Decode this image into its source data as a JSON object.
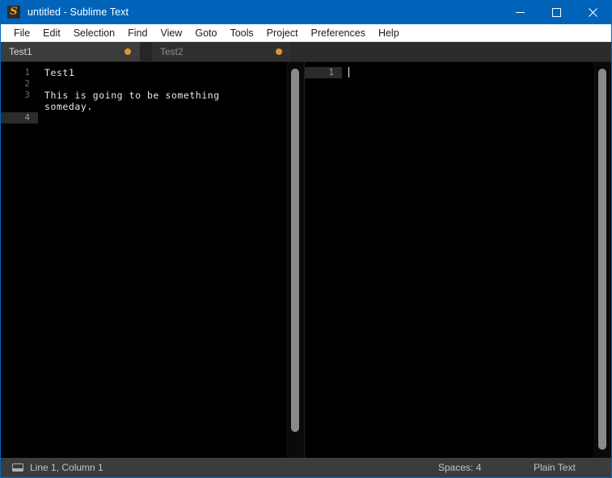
{
  "window": {
    "title": "untitled - Sublime Text",
    "logo_icon": "sublime-text-logo-icon",
    "controls": {
      "minimize": "minimize-icon",
      "maximize": "maximize-icon",
      "close": "close-icon"
    },
    "accent_color": "#0064ba"
  },
  "menubar": {
    "items": [
      {
        "label": "File"
      },
      {
        "label": "Edit"
      },
      {
        "label": "Selection"
      },
      {
        "label": "Find"
      },
      {
        "label": "View"
      },
      {
        "label": "Goto"
      },
      {
        "label": "Tools"
      },
      {
        "label": "Project"
      },
      {
        "label": "Preferences"
      },
      {
        "label": "Help"
      }
    ]
  },
  "tabs": [
    {
      "label": "Test1",
      "active": true,
      "dirty": true
    },
    {
      "label": "Test2",
      "active": false,
      "dirty": true
    }
  ],
  "panes": {
    "left": {
      "gutter": [
        "1",
        "2",
        "3",
        "",
        "4"
      ],
      "current_line": "4",
      "lines": [
        "Test1",
        "",
        "This is going to be something",
        "someday.",
        ""
      ]
    },
    "right": {
      "gutter": [
        "1"
      ],
      "current_line": "1",
      "lines": [
        ""
      ]
    }
  },
  "statusbar": {
    "sidebar_toggle_icon": "sidebar-toggle-icon",
    "cursor_position": "Line 1, Column 1",
    "indentation": "Spaces: 4",
    "syntax": "Plain Text"
  },
  "colors": {
    "titlebar": "#0064ba",
    "editor_background": "#000000",
    "tab_active": "#3c3c3c",
    "tab_inactive": "#303030",
    "dirty_dot": "#e2942c",
    "statusbar": "#3c3c3c"
  }
}
